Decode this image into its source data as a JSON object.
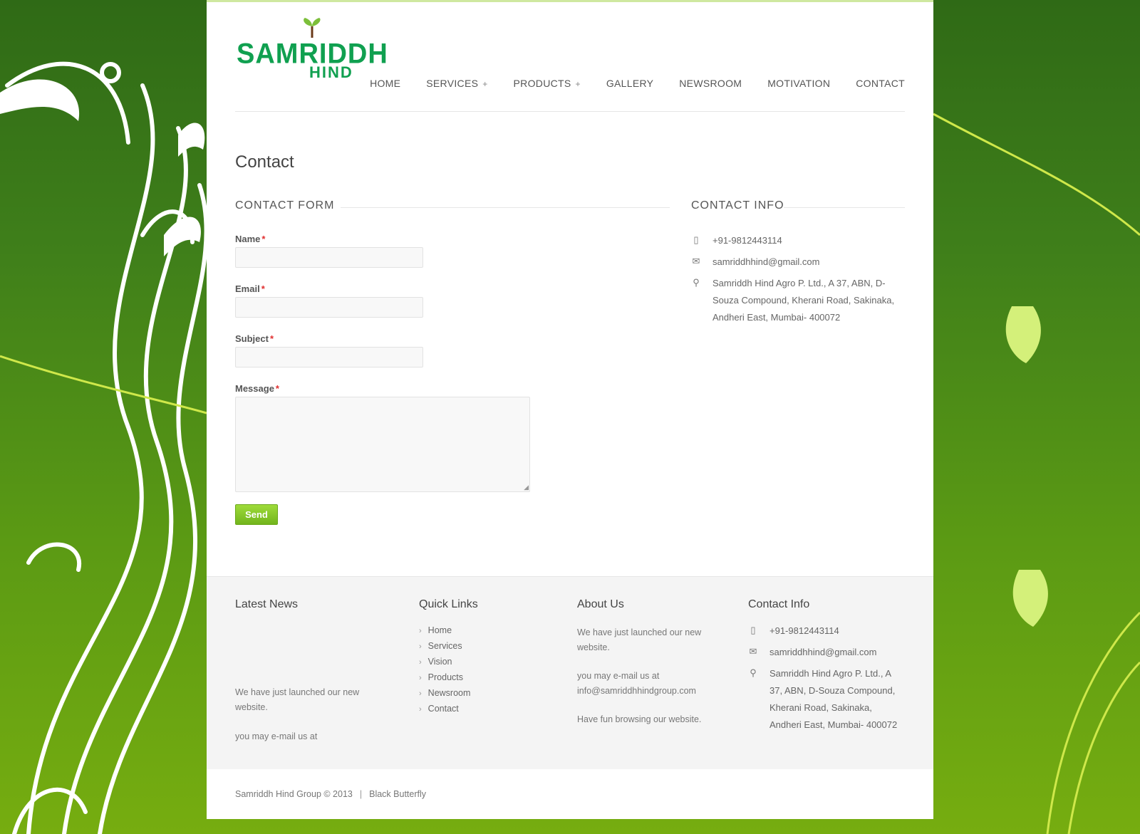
{
  "logo": {
    "word1": "SAMRIDDH",
    "word2": "HIND"
  },
  "nav": {
    "items": [
      {
        "label": "HOME",
        "has_sub": false
      },
      {
        "label": "SERVICES",
        "has_sub": true
      },
      {
        "label": "PRODUCTS",
        "has_sub": true
      },
      {
        "label": "GALLERY",
        "has_sub": false
      },
      {
        "label": "NEWSROOM",
        "has_sub": false
      },
      {
        "label": "MOTIVATION",
        "has_sub": false
      },
      {
        "label": "CONTACT",
        "has_sub": false
      }
    ],
    "plus": "+"
  },
  "page_title": "Contact",
  "form": {
    "heading": "CONTACT FORM",
    "name_label": "Name",
    "email_label": "Email",
    "subject_label": "Subject",
    "message_label": "Message",
    "required_mark": "*",
    "name_value": "",
    "email_value": "",
    "subject_value": "",
    "message_value": "",
    "send_label": "Send"
  },
  "contact_info": {
    "heading": "CONTACT INFO",
    "phone": "+91-9812443114",
    "email": "samriddhhind@gmail.com",
    "address": "Samriddh Hind Agro P. Ltd., A 37, ABN, D-Souza Compound, Kherani Road, Sakinaka, Andheri East, Mumbai- 400072"
  },
  "footer": {
    "latest_news": {
      "heading": "Latest News",
      "line1": "We have just launched our new website.",
      "line2": "you may e-mail us at"
    },
    "quick_links": {
      "heading": "Quick Links",
      "items": [
        "Home",
        "Services",
        "Vision",
        "Products",
        "Newsroom",
        "Contact"
      ]
    },
    "about": {
      "heading": "About Us",
      "line1": "We have just launched our new website.",
      "line2": "you may e-mail us at info@samriddhhindgroup.com",
      "line3": "Have fun browsing our website."
    },
    "contact_info": {
      "heading": "Contact Info",
      "phone": "+91-9812443114",
      "email": "samriddhhind@gmail.com",
      "address": "Samriddh Hind Agro P. Ltd., A 37, ABN, D-Souza Compound, Kherani Road, Sakinaka, Andheri East, Mumbai- 400072"
    }
  },
  "copyright": {
    "text": "Samriddh Hind Group © 2013",
    "separator": "|",
    "credit": "Black Butterfly"
  },
  "icons": {
    "phone": "phone-icon",
    "mail": "mail-icon",
    "location": "location-icon",
    "chevron": "chevron-right-icon"
  },
  "colors": {
    "brand_green": "#10a050",
    "button_green": "#84c62a",
    "required_red": "#e03030"
  }
}
